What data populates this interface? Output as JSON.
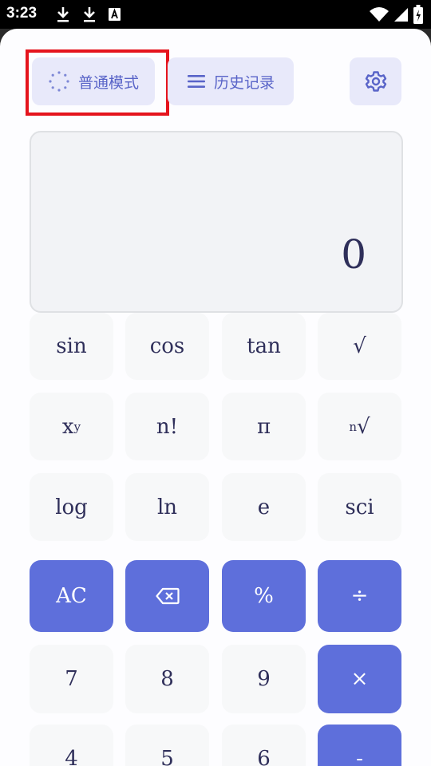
{
  "status": {
    "time": "3:23"
  },
  "top_bar": {
    "mode_label": "普通模式",
    "history_label": "历史记录"
  },
  "display": {
    "value": "0"
  },
  "keypad": {
    "row1": [
      "sin",
      "cos",
      "tan",
      "√"
    ],
    "row2": {
      "pow_base": "x",
      "pow_exp": "y",
      "factorial": "n!",
      "pi": "π",
      "nth_exp": "n",
      "nth_root": "√"
    },
    "row3": [
      "log",
      "ln",
      "e",
      "sci"
    ],
    "row4": {
      "ac": "AC",
      "percent": "%",
      "divide": "÷"
    },
    "row5": [
      "7",
      "8",
      "9",
      "×"
    ],
    "row6": [
      "4",
      "5",
      "6",
      "-"
    ]
  },
  "colors": {
    "accent": "#5e6fdb",
    "highlight": "#e5141d",
    "button_tint": "#e8e9fa"
  },
  "icons": [
    "download-icon",
    "font-a-icon",
    "wifi-icon",
    "signal-icon",
    "battery-icon",
    "loading-dots-icon",
    "menu-icon",
    "gear-icon",
    "backspace-icon"
  ]
}
